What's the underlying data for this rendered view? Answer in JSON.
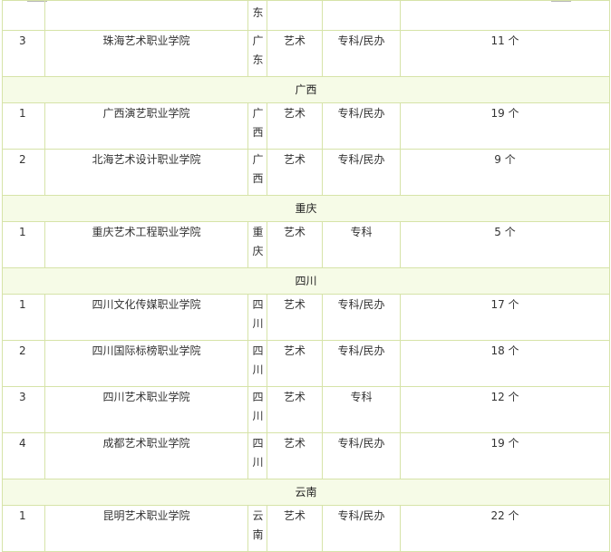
{
  "table": {
    "continuation": {
      "province_tail": "东"
    },
    "rows": [
      {
        "kind": "data",
        "idx": "3",
        "name": "珠海艺术职业学院",
        "prov": "广东",
        "type": "艺术",
        "level": "专科/民办",
        "count": "11 个"
      },
      {
        "kind": "header",
        "label": "广西"
      },
      {
        "kind": "data",
        "idx": "1",
        "name": "广西演艺职业学院",
        "prov": "广西",
        "type": "艺术",
        "level": "专科/民办",
        "count": "19 个"
      },
      {
        "kind": "data",
        "idx": "2",
        "name": "北海艺术设计职业学院",
        "prov": "广西",
        "type": "艺术",
        "level": "专科/民办",
        "count": "9 个"
      },
      {
        "kind": "header",
        "label": "重庆"
      },
      {
        "kind": "data",
        "idx": "1",
        "name": "重庆艺术工程职业学院",
        "prov": "重庆",
        "type": "艺术",
        "level": "专科",
        "count": "5 个"
      },
      {
        "kind": "header",
        "label": "四川"
      },
      {
        "kind": "data",
        "idx": "1",
        "name": "四川文化传媒职业学院",
        "prov": "四川",
        "type": "艺术",
        "level": "专科/民办",
        "count": "17 个"
      },
      {
        "kind": "data",
        "idx": "2",
        "name": "四川国际标榜职业学院",
        "prov": "四川",
        "type": "艺术",
        "level": "专科/民办",
        "count": "18 个"
      },
      {
        "kind": "data",
        "idx": "3",
        "name": "四川艺术职业学院",
        "prov": "四川",
        "type": "艺术",
        "level": "专科",
        "count": "12 个"
      },
      {
        "kind": "data",
        "idx": "4",
        "name": "成都艺术职业学院",
        "prov": "四川",
        "type": "艺术",
        "level": "专科/民办",
        "count": "19 个"
      },
      {
        "kind": "header",
        "label": "云南"
      },
      {
        "kind": "data",
        "idx": "1",
        "name": "昆明艺术职业学院",
        "prov": "云南",
        "type": "艺术",
        "level": "专科/民办",
        "count": "22 个"
      }
    ]
  },
  "colors": {
    "border": "#d6e3a8",
    "header_bg": "#f6fbe7",
    "alt_bg": "#f8fcec"
  }
}
